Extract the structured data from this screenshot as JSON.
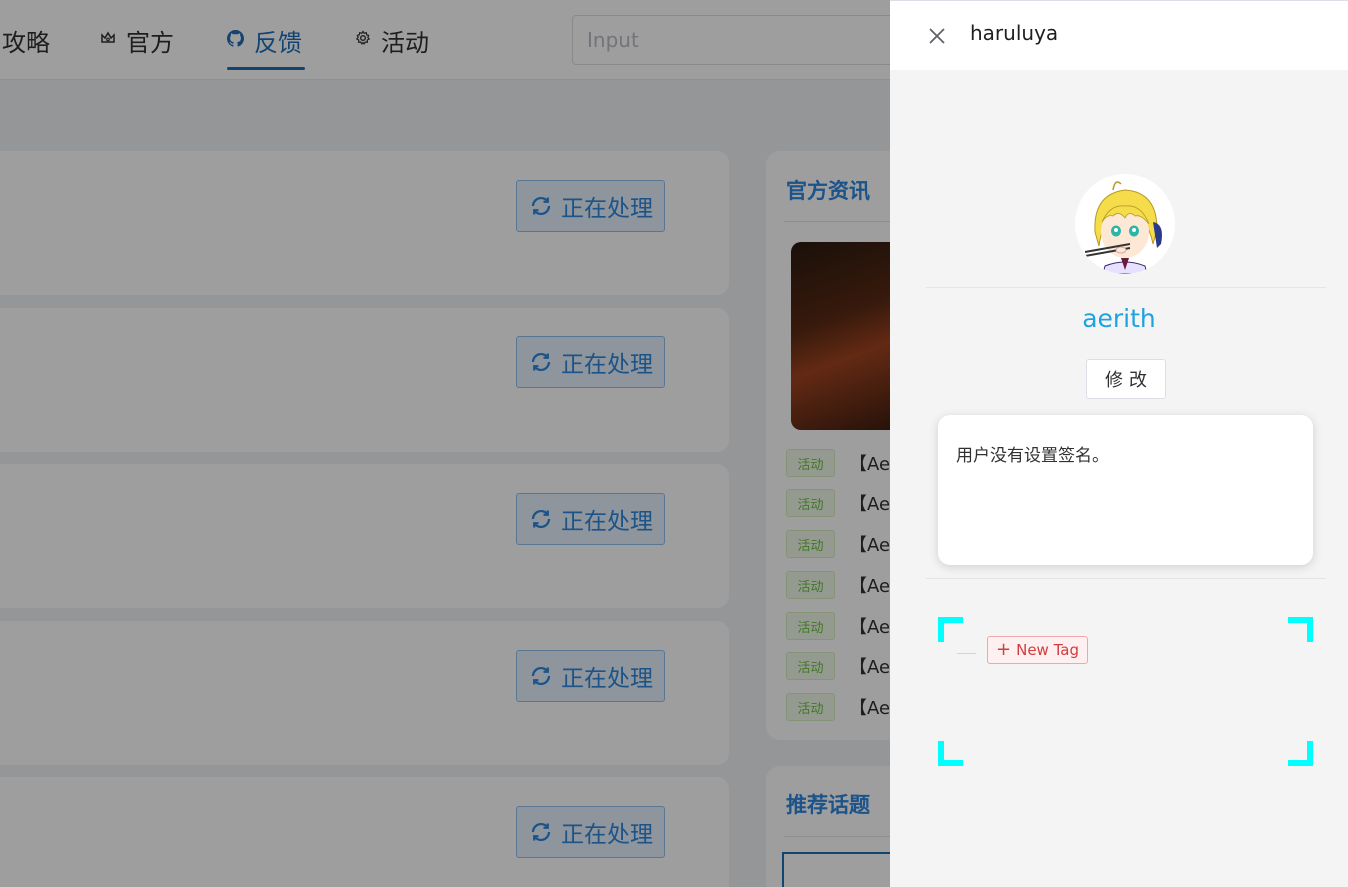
{
  "nav": {
    "items": [
      {
        "label": "攻略",
        "icon": "none"
      },
      {
        "label": "官方",
        "icon": "crown-icon"
      },
      {
        "label": "反馈",
        "icon": "github-icon",
        "active": true
      },
      {
        "label": "活动",
        "icon": "gear-icon"
      }
    ],
    "search_placeholder": "Input"
  },
  "posts": {
    "status_label": "正在处理",
    "status_icon": "refresh-icon"
  },
  "sidebar": {
    "news_title": "官方资讯",
    "news_tag": "活动",
    "news_items": [
      "【Aer",
      "【Aer",
      "【Aer",
      "【Aer",
      "【Aer",
      "【Aer",
      "【Aer"
    ],
    "topics_title": "推荐话题"
  },
  "drawer": {
    "title": "haruluya",
    "username": "aerith",
    "edit_label": "修改",
    "signature": "用户没有设置签名。",
    "new_tag_label": "New Tag",
    "colors": {
      "username": "#1fa3e0",
      "corner_brackets": "#00ffff",
      "new_tag": "#d23c3c"
    }
  }
}
